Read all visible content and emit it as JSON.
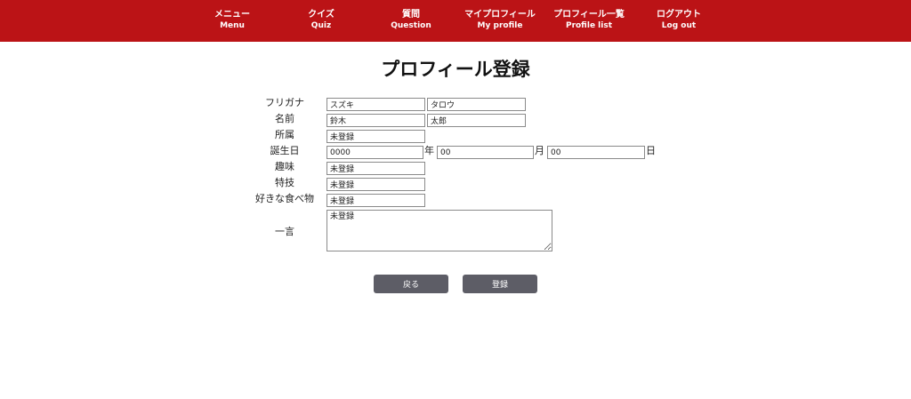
{
  "nav": {
    "items": [
      {
        "jp": "メニュー",
        "en": "Menu"
      },
      {
        "jp": "クイズ",
        "en": "Quiz"
      },
      {
        "jp": "質問",
        "en": "Question"
      },
      {
        "jp": "マイプロフィール",
        "en": "My profile"
      },
      {
        "jp": "プロフィール一覧",
        "en": "Profile list"
      },
      {
        "jp": "ログアウト",
        "en": "Log out"
      }
    ]
  },
  "colors": {
    "nav_bg": "#bb1316",
    "button_bg": "#5d5d66"
  },
  "form": {
    "title": "プロフィール登録",
    "furigana": {
      "label": "フリガナ",
      "last": "スズキ",
      "first": "タロウ"
    },
    "name": {
      "label": "名前",
      "last": "鈴木",
      "first": "太郎"
    },
    "affiliation": {
      "label": "所属",
      "value": "未登録"
    },
    "birthday": {
      "label": "誕生日",
      "year": "0000",
      "year_unit": "年",
      "month": "00",
      "month_unit": "月",
      "day": "00",
      "day_unit": "日"
    },
    "hobby": {
      "label": "趣味",
      "value": "未登録"
    },
    "skill": {
      "label": "特技",
      "value": "未登録"
    },
    "favorite_food": {
      "label": "好きな食べ物",
      "value": "未登録"
    },
    "comment": {
      "label": "一言",
      "value": "未登録"
    }
  },
  "buttons": {
    "back": "戻る",
    "register": "登録"
  }
}
